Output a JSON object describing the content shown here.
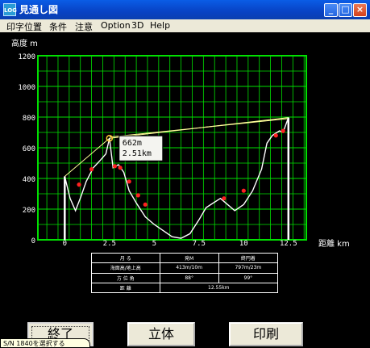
{
  "window": {
    "title": "見通し図",
    "app_icon": "app-map-icon",
    "controls": [
      "minimize-icon",
      "maximize-icon",
      "close-icon"
    ],
    "control_glyphs": [
      "_",
      "□",
      "×"
    ],
    "app_icon_text": "LOG"
  },
  "menu": [
    "印字位置",
    "条件",
    "注意",
    "Option",
    "3D",
    "Help"
  ],
  "chart_data": {
    "type": "line",
    "ylabel": "高度 m",
    "xlabel": "距離 km",
    "ylim": [
      0,
      1200
    ],
    "xlim": [
      -1.5,
      13.5
    ],
    "y_ticks": [
      0,
      200,
      400,
      600,
      800,
      1000,
      1200
    ],
    "y_tick_labels": [
      "0",
      "200",
      "400",
      "600",
      "800",
      "1000",
      "1200"
    ],
    "x_ticks": [
      0,
      2.5,
      5,
      7.5,
      10,
      12.5
    ],
    "x_tick_labels": [
      "0",
      "2.5",
      "5",
      "7.5",
      "10",
      "12.5"
    ],
    "colors": {
      "grid": "#00e000",
      "profile": "#ffffff",
      "sightline": "#ffff99",
      "markers": "#ff2020"
    },
    "profile": {
      "x": [
        0,
        0.3,
        0.6,
        0.9,
        1.2,
        1.6,
        2.0,
        2.3,
        2.5,
        2.7,
        3.0,
        3.3,
        3.6,
        4.0,
        4.5,
        5.0,
        5.5,
        6.0,
        6.5,
        7.0,
        7.5,
        7.9,
        8.3,
        8.7,
        9.1,
        9.5,
        10.0,
        10.5,
        11.0,
        11.3,
        11.6,
        12.0,
        12.2,
        12.5
      ],
      "y": [
        413,
        270,
        190,
        280,
        380,
        470,
        520,
        560,
        662,
        470,
        490,
        440,
        320,
        240,
        150,
        100,
        60,
        20,
        10,
        40,
        130,
        210,
        240,
        270,
        230,
        190,
        230,
        320,
        460,
        630,
        680,
        710,
        700,
        797
      ]
    },
    "sightlines": [
      {
        "x": [
          0,
          2.5
        ],
        "y": [
          413,
          662
        ]
      },
      {
        "x": [
          2.5,
          12.5
        ],
        "y": [
          662,
          797
        ]
      },
      {
        "x": [
          2.5,
          12.5
        ],
        "y": [
          670,
          790
        ]
      }
    ],
    "markers": [
      {
        "x": 0.8,
        "y": 360
      },
      {
        "x": 1.5,
        "y": 460
      },
      {
        "x": 2.8,
        "y": 480
      },
      {
        "x": 3.1,
        "y": 470
      },
      {
        "x": 3.6,
        "y": 380
      },
      {
        "x": 4.1,
        "y": 290
      },
      {
        "x": 4.5,
        "y": 230
      },
      {
        "x": 8.9,
        "y": 270
      },
      {
        "x": 10.0,
        "y": 320
      },
      {
        "x": 11.8,
        "y": 680
      },
      {
        "x": 12.2,
        "y": 710
      }
    ],
    "annotation": {
      "x": 2.5,
      "y": 662,
      "lines": [
        "662m",
        "2.51km"
      ]
    },
    "endpoints": [
      {
        "x": 0,
        "y": 413
      },
      {
        "x": 12.5,
        "y": 797
      }
    ]
  },
  "stats_table": {
    "header": [
      "月 る",
      "発M",
      "終円着"
    ],
    "rows": [
      [
        "海面高/地上高",
        "413m/10m",
        "797m/23m"
      ],
      [
        "方 位 角",
        "88°",
        "99°"
      ],
      [
        "距 離",
        "12.55km",
        ""
      ]
    ]
  },
  "buttons": {
    "exit": "終了",
    "three_d": "立体",
    "print": "印刷"
  },
  "tooltip": "S/N 1840を選択する"
}
